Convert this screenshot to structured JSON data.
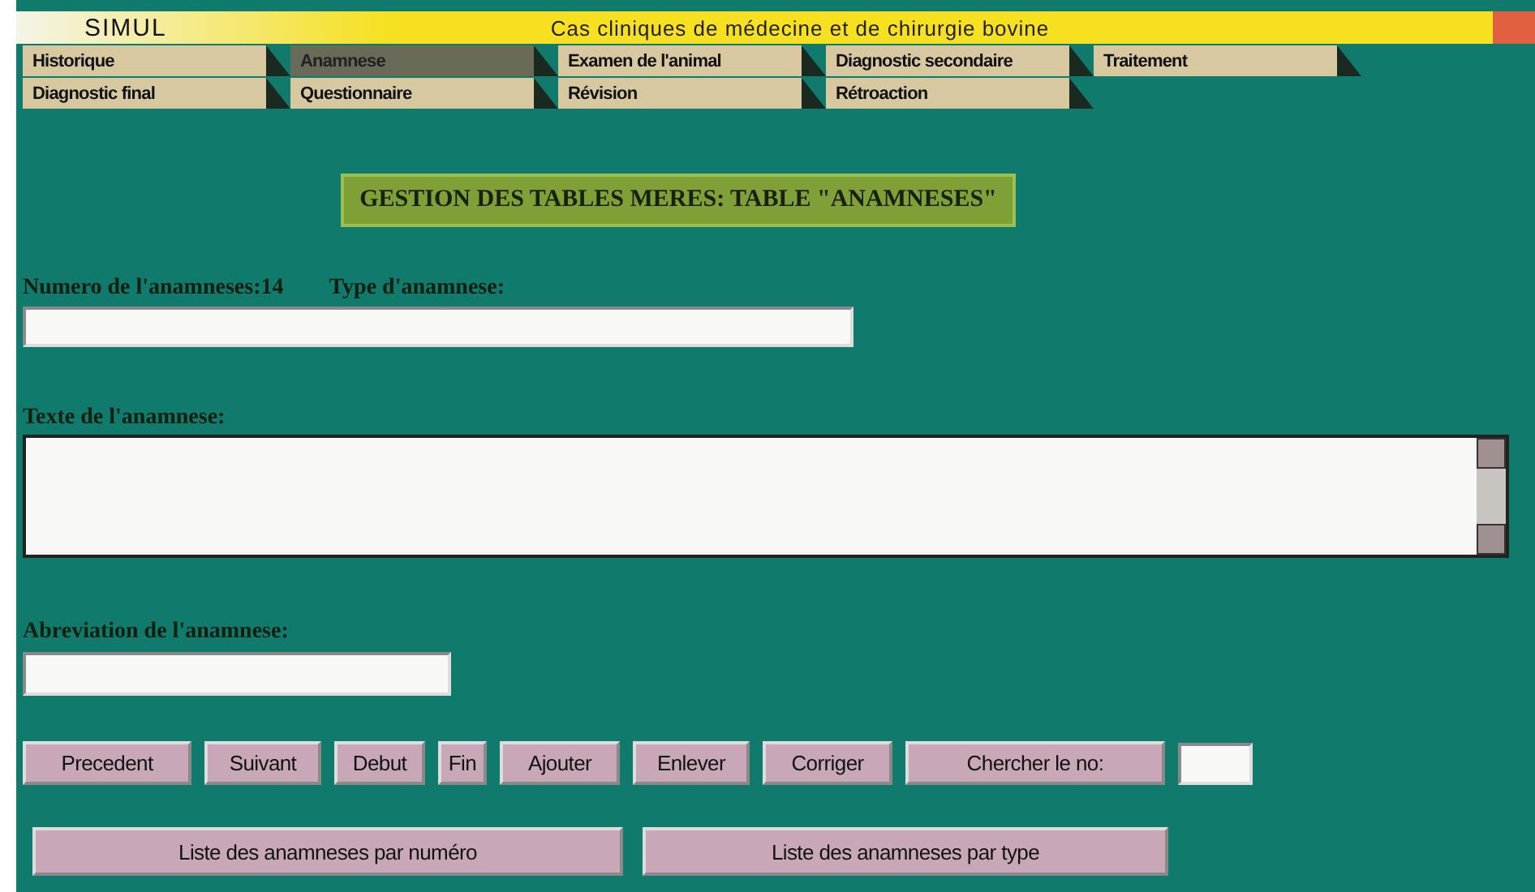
{
  "title_bar": {
    "app": "SIMUL",
    "title": "Cas cliniques de médecine et de chirurgie bovine"
  },
  "tab_rows": [
    [
      {
        "label": "Historique",
        "selected": false
      },
      {
        "label": "Anamnese",
        "selected": true
      },
      {
        "label": "Examen de l'animal",
        "selected": false
      },
      {
        "label": "Diagnostic secondaire",
        "selected": false
      },
      {
        "label": "Traitement",
        "selected": false
      }
    ],
    [
      {
        "label": "Diagnostic final",
        "selected": false
      },
      {
        "label": "Questionnaire",
        "selected": false
      },
      {
        "label": "Révision",
        "selected": false
      },
      {
        "label": "Rétroaction",
        "selected": false
      }
    ]
  ],
  "heading": "GESTION DES TABLES MERES: TABLE \"ANAMNESES\"",
  "number_label": "Numero de l'anamneses:14",
  "type_label": "Type d'anamnese:",
  "text_label": "Texte de l'anamnese:",
  "abbrev_label": "Abreviation de l'anamnese:",
  "nav_buttons": [
    "Precedent",
    "Suivant",
    "Debut",
    "Fin",
    "Ajouter",
    "Enlever",
    "Corriger",
    "Chercher le no:"
  ],
  "list_buttons": [
    "Liste des anamneses par numéro",
    "Liste des anamneses par type"
  ]
}
